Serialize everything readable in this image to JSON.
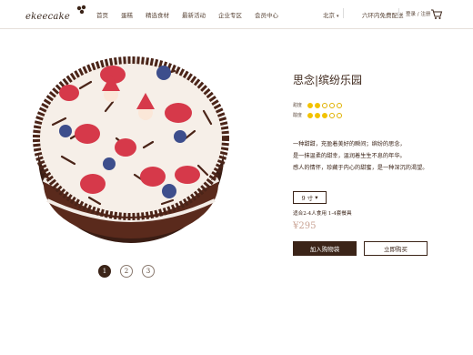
{
  "header": {
    "logo_text": "ekeecake",
    "nav": [
      "首页",
      "蛋糕",
      "精选食材",
      "最新活动",
      "企业专区",
      "会员中心"
    ],
    "city": "北京",
    "delivery": "六环内免费配送",
    "login": "登录 / 注册"
  },
  "product": {
    "title": "思念|缤纷乐园",
    "ratings": [
      {
        "label": "甜度",
        "value": 2,
        "max": 5
      },
      {
        "label": "酸度",
        "value": 3,
        "max": 5
      }
    ],
    "desc_lines": [
      "一种甜甜，充盈着美好的瞬间；缤纷的思念，",
      "是一抹温柔的甜幸，温润着生生不息的年华。",
      "感人的情怀，珍藏于内心的甜蜜，是一种深沉的渴望。"
    ],
    "size": "9 寸",
    "size_caret": "▾",
    "serving": "适合2-4人食用 1-4套餐具",
    "price": "¥295",
    "add_cart_label": "加入购物袋",
    "buy_now_label": "立即购买"
  },
  "pager": {
    "pages": [
      "1",
      "2",
      "3"
    ],
    "active": 0
  },
  "colors": {
    "brand": "#3b2418",
    "rating": "#f2c200",
    "price": "#c9a394"
  }
}
